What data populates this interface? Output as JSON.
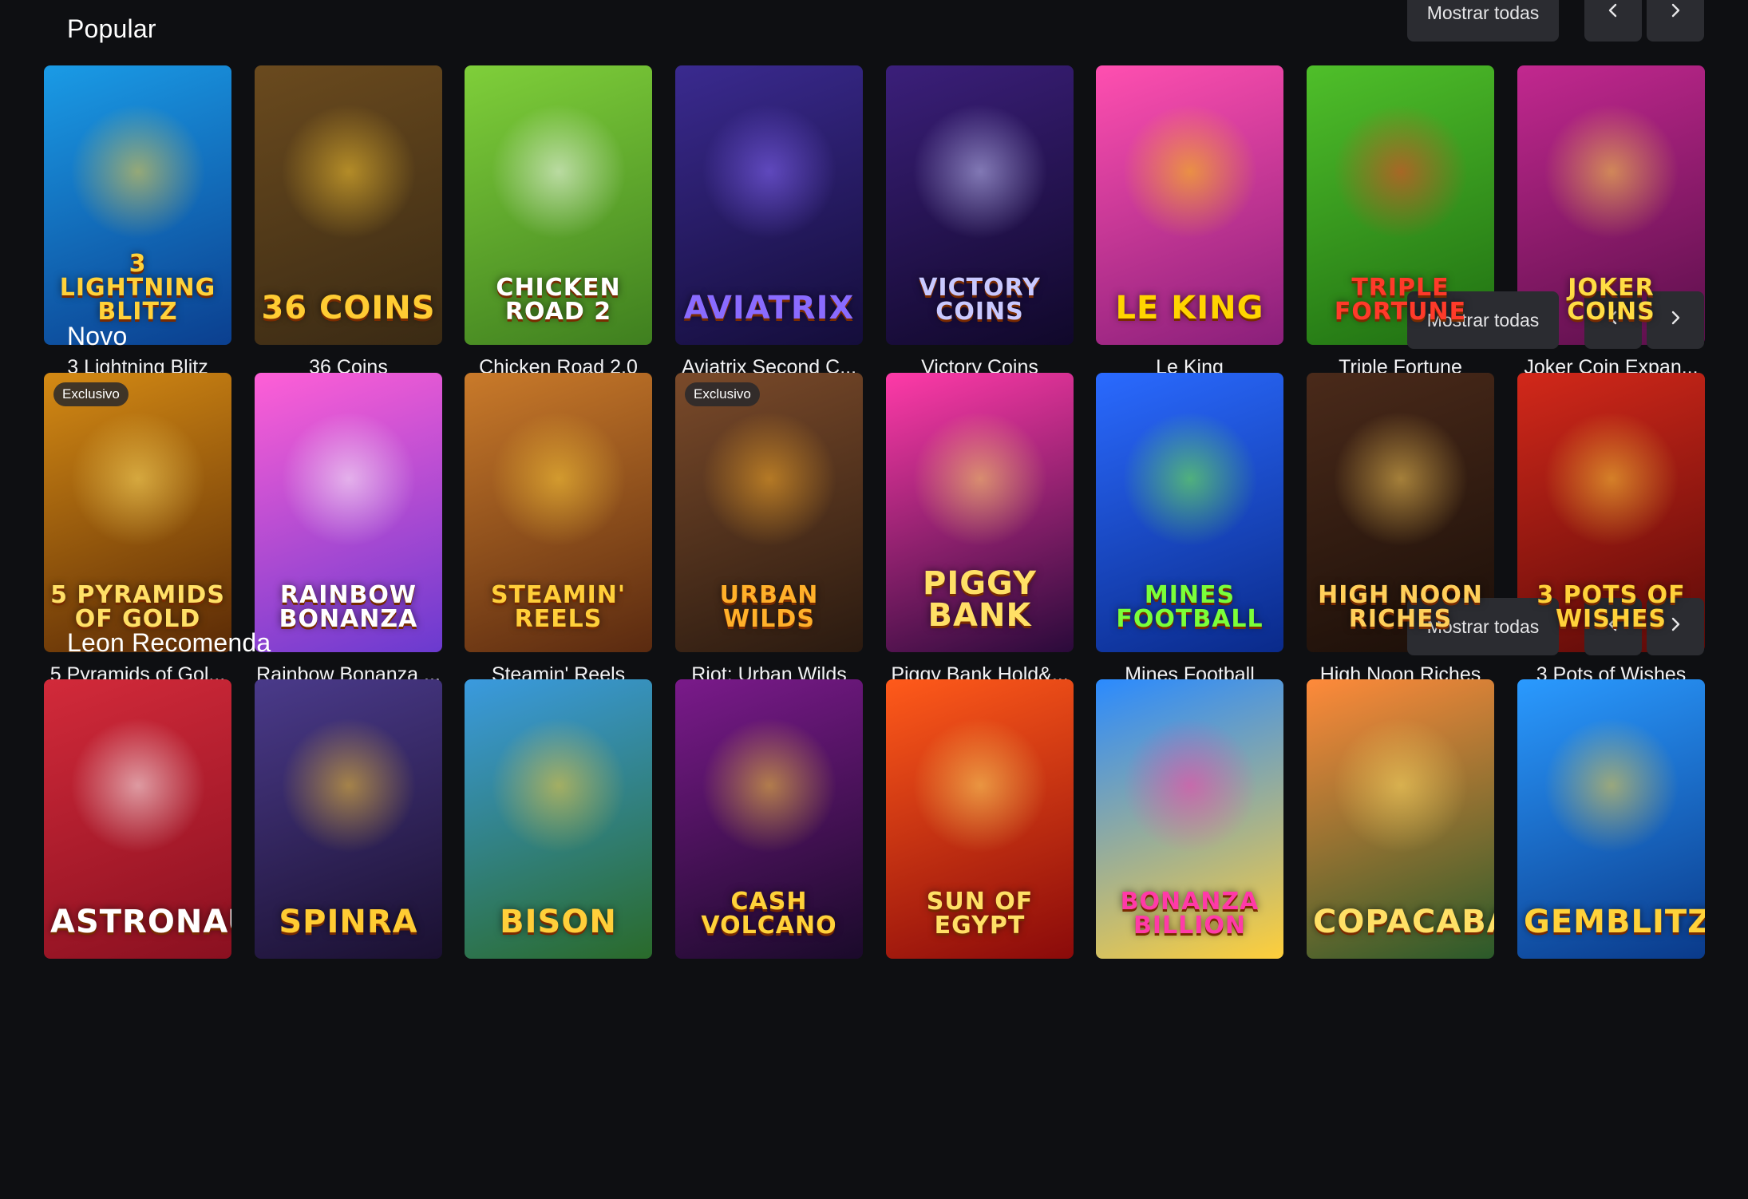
{
  "controls": {
    "show_all": "Mostrar todas",
    "prev_icon": "chevron-left-icon",
    "next_icon": "chevron-right-icon"
  },
  "sections": [
    {
      "title": "Popular",
      "games": [
        {
          "title": "3 Lightning Blitz",
          "art": "3 LIGHTNING BLITZ",
          "bg": [
            "#1a9be6",
            "#0b3f8f"
          ],
          "accent": "#ffd23a"
        },
        {
          "title": "36 Coins",
          "art": "36 COINS",
          "bg": [
            "#6a4a1e",
            "#3a2a14"
          ],
          "accent": "#ffcc33"
        },
        {
          "title": "Chicken Road 2.0",
          "art": "CHICKEN ROAD 2",
          "bg": [
            "#7fcf3a",
            "#3f7f1f"
          ],
          "accent": "#ffffff"
        },
        {
          "title": "Aviatrix Second C...",
          "art": "Aviatrix",
          "bg": [
            "#3a2a8f",
            "#140d3a"
          ],
          "accent": "#8a6bff"
        },
        {
          "title": "Victory Coins",
          "art": "VICTORY COINS",
          "bg": [
            "#3b1f7a",
            "#10082a"
          ],
          "accent": "#c9c9ff"
        },
        {
          "title": "Le King",
          "art": "LE KING",
          "bg": [
            "#ff4fb0",
            "#8a1f7a"
          ],
          "accent": "#ffd400"
        },
        {
          "title": "Triple Fortune",
          "art": "TRIPLE FORTUNE",
          "bg": [
            "#4fbf2a",
            "#1f6f12"
          ],
          "accent": "#ff3a2a"
        },
        {
          "title": "Joker Coin Expan...",
          "art": "JOKER COINS",
          "bg": [
            "#c2288f",
            "#5a0f4a"
          ],
          "accent": "#ffdd44"
        }
      ]
    },
    {
      "title": "Novo",
      "games": [
        {
          "title": "5 Pyramids of Gol...",
          "art": "5 PYRAMIDS OF GOLD",
          "bg": [
            "#d48a14",
            "#5a2a06"
          ],
          "accent": "#ffe066",
          "badge": "Exclusivo"
        },
        {
          "title": "Rainbow Bonanza ...",
          "art": "RAINBOW BONANZA",
          "bg": [
            "#ff5fd6",
            "#6a3acf"
          ],
          "accent": "#ffffff"
        },
        {
          "title": "Steamin' Reels",
          "art": "STEAMIN' REELS",
          "bg": [
            "#c97a2a",
            "#5a2a10"
          ],
          "accent": "#ffcf3a"
        },
        {
          "title": "Riot: Urban Wilds",
          "art": "URBAN WILDS",
          "bg": [
            "#7a4a2a",
            "#2a1a10"
          ],
          "accent": "#ffb02a",
          "badge": "Exclusivo"
        },
        {
          "title": "Piggy Bank Hold&...",
          "art": "PIGGY BANK",
          "bg": [
            "#ff3aa8",
            "#2a0a3a"
          ],
          "accent": "#ffe066"
        },
        {
          "title": "Mines Football",
          "art": "MINES FOOTBALL",
          "bg": [
            "#2a6aff",
            "#0a2a8a"
          ],
          "accent": "#7aff3a"
        },
        {
          "title": "High Noon Riches",
          "art": "HIGH NOON RICHES",
          "bg": [
            "#4a2a1a",
            "#1a0e08"
          ],
          "accent": "#ffcf5a"
        },
        {
          "title": "3 Pots of Wishes",
          "art": "3 POTS OF WISHES",
          "bg": [
            "#d2281a",
            "#5a0a08"
          ],
          "accent": "#ffd23a"
        }
      ]
    },
    {
      "title": "Leon Recomenda",
      "games": [
        {
          "title": "",
          "art": "Astronaut",
          "bg": [
            "#d22a3a",
            "#8a1020"
          ],
          "accent": "#ffffff"
        },
        {
          "title": "",
          "art": "SPINRA",
          "bg": [
            "#4a3a8a",
            "#1a1030"
          ],
          "accent": "#ffcc33"
        },
        {
          "title": "",
          "art": "BISON",
          "bg": [
            "#3a9adf",
            "#2a6a2a"
          ],
          "accent": "#ffcf3a"
        },
        {
          "title": "",
          "art": "CASH VOLCANO",
          "bg": [
            "#7a1a8a",
            "#1a0a2a"
          ],
          "accent": "#ffd23a"
        },
        {
          "title": "",
          "art": "SUN OF EGYPT",
          "bg": [
            "#ff5a1a",
            "#8a0a0a"
          ],
          "accent": "#ffe066"
        },
        {
          "title": "",
          "art": "BONANZA BILLION",
          "bg": [
            "#2a8aff",
            "#ffcf3a"
          ],
          "accent": "#ff3aa8"
        },
        {
          "title": "",
          "art": "COPACABANA",
          "bg": [
            "#ff8a3a",
            "#2a5a2a"
          ],
          "accent": "#ffe066"
        },
        {
          "title": "",
          "art": "GEMBLITZ",
          "bg": [
            "#2a9aff",
            "#0a3a8a"
          ],
          "accent": "#ffd23a"
        }
      ]
    }
  ]
}
